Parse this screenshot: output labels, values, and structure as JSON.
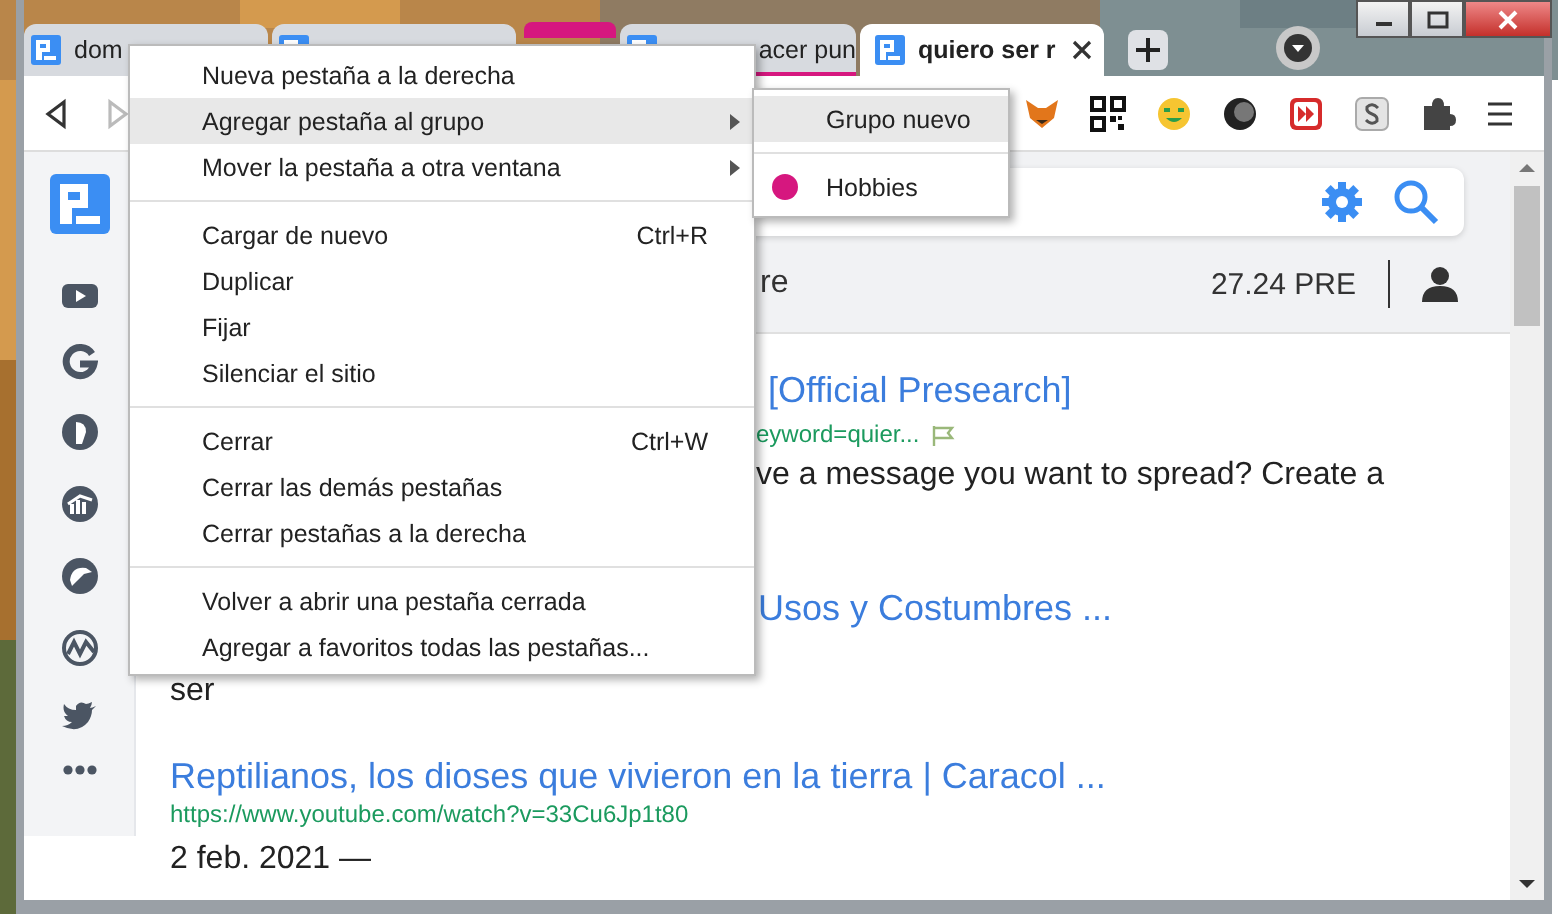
{
  "tabs": [
    {
      "kind": "tab",
      "title": "dom",
      "selected": false
    },
    {
      "kind": "tab",
      "selected": false
    },
    {
      "kind": "group",
      "color": "#d6177f"
    },
    {
      "kind": "tab",
      "title": "acer pun",
      "selected": false,
      "color": "#d6177f"
    },
    {
      "kind": "tab",
      "title": "quiero ser r",
      "selected": true
    }
  ],
  "page": {
    "header_text": "re",
    "balance": "27.24 PRE",
    "results": [
      {
        "title": "[Official Presearch]",
        "url": "eyword=quier...",
        "snippet": "ve a message you want to spread? Create a"
      },
      {
        "title": "Usos y Costumbres ...",
        "snippet": "ser"
      },
      {
        "title": "Reptilianos, los dioses que vivieron en la tierra | Caracol ...",
        "url": "https://www.youtube.com/watch?v=33Cu6Jp1t80",
        "snippet": "2 feb. 2021 —"
      }
    ]
  },
  "context_menu": {
    "sections": [
      [
        {
          "label": "Nueva pestaña a la derecha",
          "selected": false,
          "submenu": false
        },
        {
          "label": "Agregar pestaña al grupo",
          "selected": true,
          "submenu": true
        },
        {
          "label": "Mover la pestaña a otra ventana",
          "selected": false,
          "submenu": true
        }
      ],
      [
        {
          "label": "Cargar de nuevo",
          "shortcut": "Ctrl+R",
          "selected": false,
          "submenu": false
        },
        {
          "label": "Duplicar",
          "selected": false,
          "submenu": false
        },
        {
          "label": "Fijar",
          "selected": false,
          "submenu": false
        },
        {
          "label": "Silenciar el sitio",
          "selected": false,
          "submenu": false
        }
      ],
      [
        {
          "label": "Cerrar",
          "shortcut": "Ctrl+W",
          "selected": false,
          "submenu": false
        },
        {
          "label": "Cerrar las demás pestañas",
          "selected": false,
          "submenu": false
        },
        {
          "label": "Cerrar pestañas a la derecha",
          "selected": false,
          "submenu": false
        }
      ],
      [
        {
          "label": "Volver a abrir una pestaña cerrada",
          "selected": false,
          "submenu": false
        },
        {
          "label": "Agregar a favoritos todas las pestañas...",
          "selected": false,
          "submenu": false
        }
      ]
    ]
  },
  "submenu": {
    "sections": [
      [
        {
          "kind": "action",
          "label": "Grupo nuevo",
          "selected": true
        }
      ],
      [
        {
          "kind": "group",
          "label": "Hobbies",
          "color": "#d6177f",
          "selected": false
        }
      ]
    ]
  }
}
